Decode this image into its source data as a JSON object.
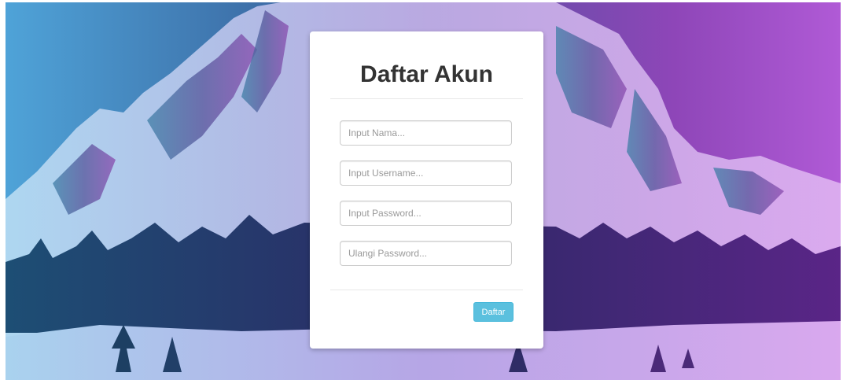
{
  "colors": {
    "gradient_left": "#4fa3d8",
    "gradient_right": "#b05ad6",
    "card_background": "#ffffff",
    "title_text": "#333333",
    "button_background": "#5bc0de",
    "button_text": "#ffffff"
  },
  "background": {
    "icon": "mountain-landscape-image"
  },
  "form": {
    "title": "Daftar Akun",
    "fields": {
      "nama_placeholder": "Input Nama...",
      "username_placeholder": "Input Username...",
      "password_placeholder": "Input Password...",
      "ulangi_password_placeholder": "Ulangi Password..."
    },
    "submit_label": "Daftar"
  }
}
